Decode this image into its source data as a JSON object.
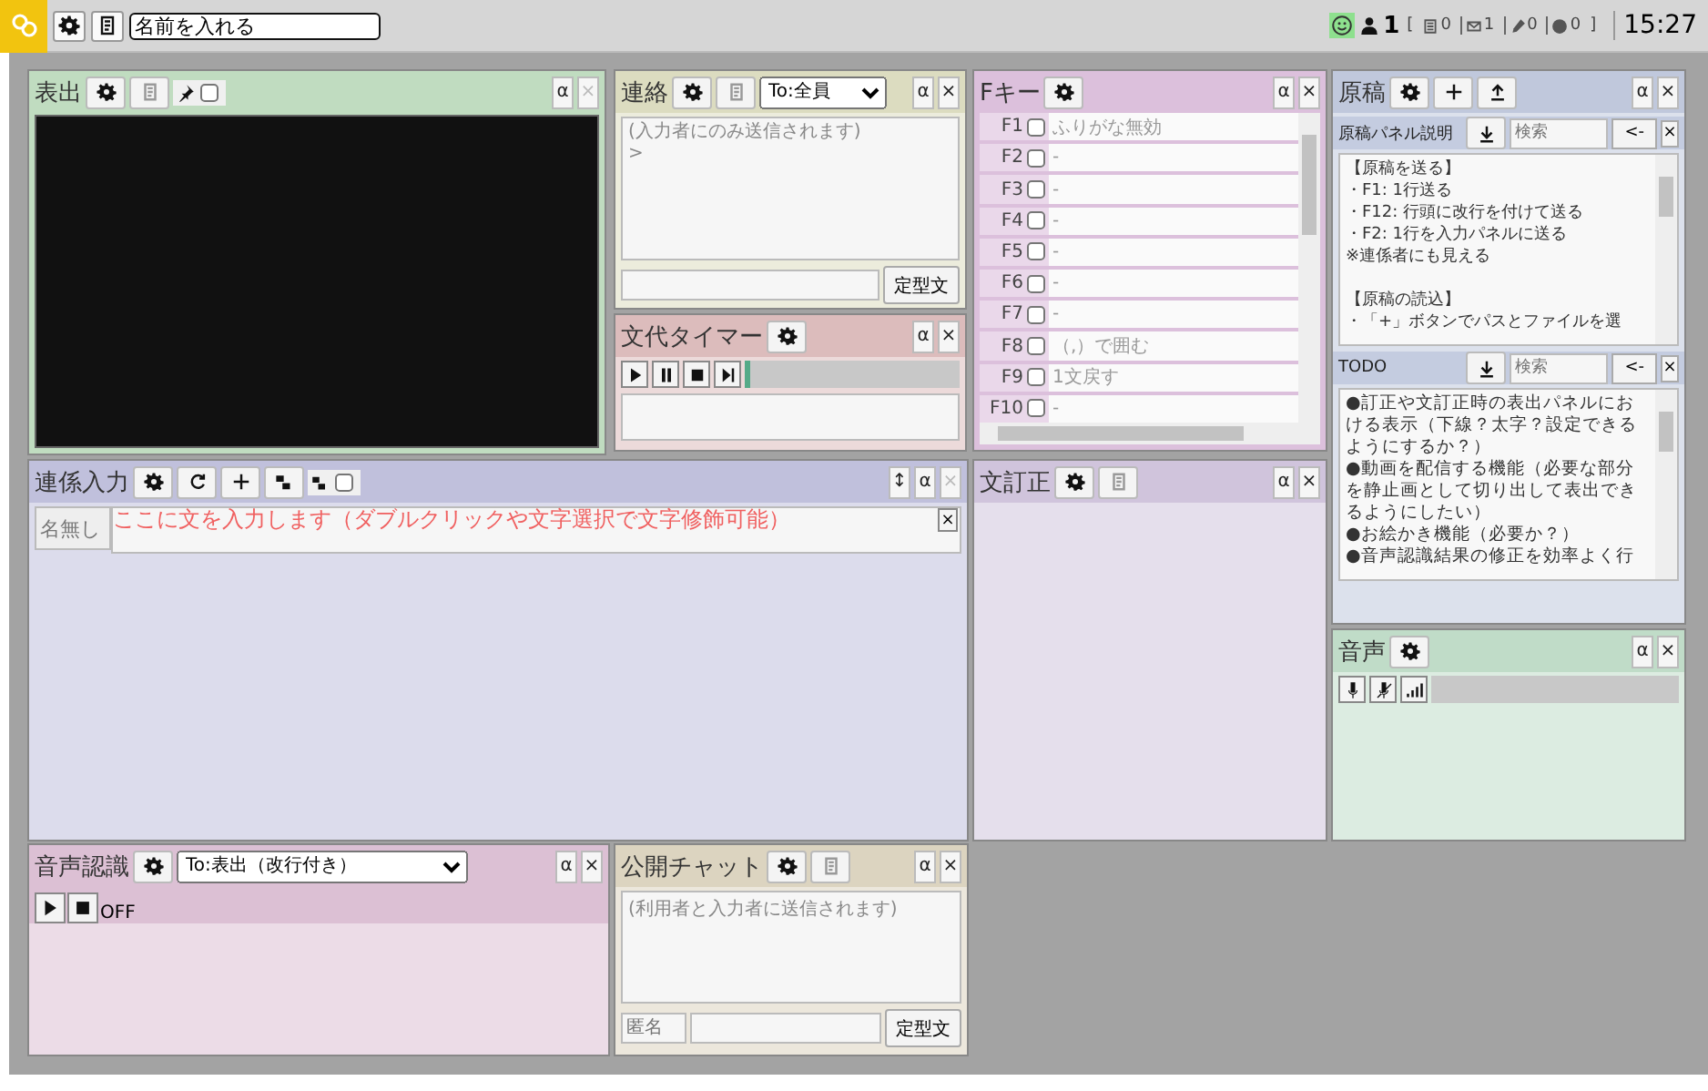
{
  "topbar": {
    "buttons": [
      {
        "kind": "logo"
      },
      {
        "kind": "gear"
      },
      {
        "kind": "notes"
      }
    ],
    "name_field": {
      "value": "名前を入れる"
    },
    "status": {
      "connected": true
    },
    "user_count": "1",
    "open_bracket": "[",
    "counters": [
      {
        "kind": "doc",
        "value": "0"
      },
      {
        "kind": "mail",
        "value": "1"
      },
      {
        "kind": "pen",
        "value": "0"
      },
      {
        "kind": "disc",
        "value": "0"
      }
    ],
    "close_bracket": "]",
    "time": "15:27"
  },
  "panels": [
    {
      "kind": "display",
      "title": "表出",
      "color": "#c0dcc0",
      "buttons": [
        {
          "kind": "gear",
          "disabled": false
        },
        {
          "kind": "notes",
          "disabled": true
        }
      ],
      "pin": {
        "checked": false
      },
      "corner": [
        {
          "label": "α",
          "disabled": false
        },
        {
          "label": "×",
          "disabled": true
        }
      ]
    },
    {
      "kind": "contact",
      "title": "連絡",
      "color": "#dcdcc0",
      "buttons": [
        {
          "kind": "gear",
          "disabled": false
        },
        {
          "kind": "notes",
          "disabled": true
        }
      ],
      "recipient": "To:全員",
      "corner": [
        {
          "label": "α",
          "disabled": false
        },
        {
          "label": "×",
          "disabled": false
        }
      ],
      "log_lines": [
        "(入力者にのみ送信されます)",
        ">"
      ],
      "template_button": "定型文"
    },
    {
      "kind": "timer",
      "title": "文代タイマー",
      "color": "#dcbcbc",
      "buttons": [
        {
          "kind": "gear",
          "disabled": false
        }
      ],
      "corner": [
        {
          "label": "α",
          "disabled": false
        },
        {
          "label": "×",
          "disabled": false
        }
      ],
      "controls": [
        {
          "kind": "play"
        },
        {
          "kind": "pause"
        },
        {
          "kind": "stop"
        },
        {
          "kind": "skip"
        }
      ],
      "progress": {
        "level": 0
      }
    },
    {
      "kind": "fkeys",
      "title": "Fキー",
      "color": "#dcc0dc",
      "buttons": [
        {
          "kind": "gear",
          "disabled": false
        }
      ],
      "corner": [
        {
          "label": "α",
          "disabled": false
        },
        {
          "label": "×",
          "disabled": false
        }
      ],
      "keys": [
        {
          "key": "F1",
          "checked": false,
          "action": "ふりがな無効"
        },
        {
          "key": "F2",
          "checked": false,
          "action": "-"
        },
        {
          "key": "F3",
          "checked": false,
          "action": "-"
        },
        {
          "key": "F4",
          "checked": false,
          "action": "-"
        },
        {
          "key": "F5",
          "checked": false,
          "action": "-"
        },
        {
          "key": "F6",
          "checked": false,
          "action": "-"
        },
        {
          "key": "F7",
          "checked": false,
          "action": "-"
        },
        {
          "key": "F8",
          "checked": false,
          "action": "（,）で囲む"
        },
        {
          "key": "F9",
          "checked": false,
          "action": "1文戻す"
        },
        {
          "key": "F10",
          "checked": false,
          "action": "-"
        }
      ]
    },
    {
      "kind": "manuscript",
      "title": "原稿",
      "color": "#c0c8dc",
      "buttons": [
        {
          "kind": "gear",
          "disabled": false
        },
        {
          "kind": "plus",
          "disabled": false
        },
        {
          "kind": "upload",
          "disabled": false
        }
      ],
      "corner": [
        {
          "label": "α",
          "disabled": false
        },
        {
          "label": "×",
          "disabled": false
        }
      ],
      "sections": [
        {
          "title": "原稿パネル説明",
          "search": {
            "placeholder": "検索"
          },
          "back": "<-",
          "close": "×",
          "lines": [
            "【原稿を送る】",
            "・F1: 1行送る",
            "・F12: 行頭に改行を付けて送る",
            "・F2: 1行を入力パネルに送る",
            "※連係者にも見える"
          ],
          "more_lines": [
            "【原稿の読込】",
            "・「+」ボタンでパスとファイルを選"
          ]
        },
        {
          "title": "TODO",
          "search": {
            "placeholder": "検索"
          },
          "back": "<-",
          "close": "×",
          "lines": [
            "●訂正や文訂正時の表出パネルにおける表示（下線？太字？設定できるようにするか？）",
            "●動画を配信する機能（必要な部分を静止画として切り出して表出できるようにしたい）",
            "●お絵かき機能（必要か？）",
            "●音声認識結果の修正を効率よく行"
          ]
        }
      ]
    },
    {
      "kind": "voice",
      "title": "音声",
      "color": "#c0dcc8",
      "buttons": [
        {
          "kind": "gear",
          "disabled": false
        }
      ],
      "corner": [
        {
          "label": "α",
          "disabled": false
        },
        {
          "label": "×",
          "disabled": false
        }
      ],
      "tools": [
        {
          "kind": "mic"
        },
        {
          "kind": "mic-off"
        },
        {
          "kind": "signal"
        }
      ]
    },
    {
      "kind": "linked",
      "title": "連係入力",
      "color": "#c0c0dc",
      "buttons": [
        {
          "kind": "gear",
          "disabled": false
        },
        {
          "kind": "refresh",
          "disabled": false
        },
        {
          "kind": "plus",
          "disabled": false
        },
        {
          "kind": "blocks",
          "disabled": false
        }
      ],
      "link": {
        "checked": false
      },
      "corner": [
        {
          "label": "↕",
          "disabled": false
        },
        {
          "label": "α",
          "disabled": false
        },
        {
          "label": "×",
          "disabled": true
        }
      ],
      "name_button": "名無し",
      "input": {
        "placeholder": "ここに文を入力します（ダブルクリックや文字選択で文字修飾可能）"
      },
      "clear": "×"
    },
    {
      "kind": "correction",
      "title": "文訂正",
      "color": "#d0c4dc",
      "buttons": [
        {
          "kind": "gear",
          "disabled": false
        },
        {
          "kind": "notes",
          "disabled": true
        }
      ],
      "corner": [
        {
          "label": "α",
          "disabled": false
        },
        {
          "label": "×",
          "disabled": false
        }
      ]
    },
    {
      "kind": "speech",
      "title": "音声認識",
      "color": "#dcc0d4",
      "buttons": [
        {
          "kind": "gear",
          "disabled": false
        }
      ],
      "target": "To:表出（改行付き）",
      "corner": [
        {
          "label": "α",
          "disabled": false
        },
        {
          "label": "×",
          "disabled": false
        }
      ],
      "controls": [
        {
          "kind": "play"
        },
        {
          "kind": "stop"
        }
      ],
      "state": "OFF"
    },
    {
      "kind": "chat",
      "title": "公開チャット",
      "color": "#dcd4c0",
      "buttons": [
        {
          "kind": "gear",
          "disabled": false
        },
        {
          "kind": "notes",
          "disabled": true
        }
      ],
      "corner": [
        {
          "label": "α",
          "disabled": false
        },
        {
          "label": "×",
          "disabled": false
        }
      ],
      "message": {
        "placeholder": "(利用者と入力者に送信されます)"
      },
      "sender": {
        "placeholder": "匿名"
      },
      "template_button": "定型文"
    }
  ]
}
